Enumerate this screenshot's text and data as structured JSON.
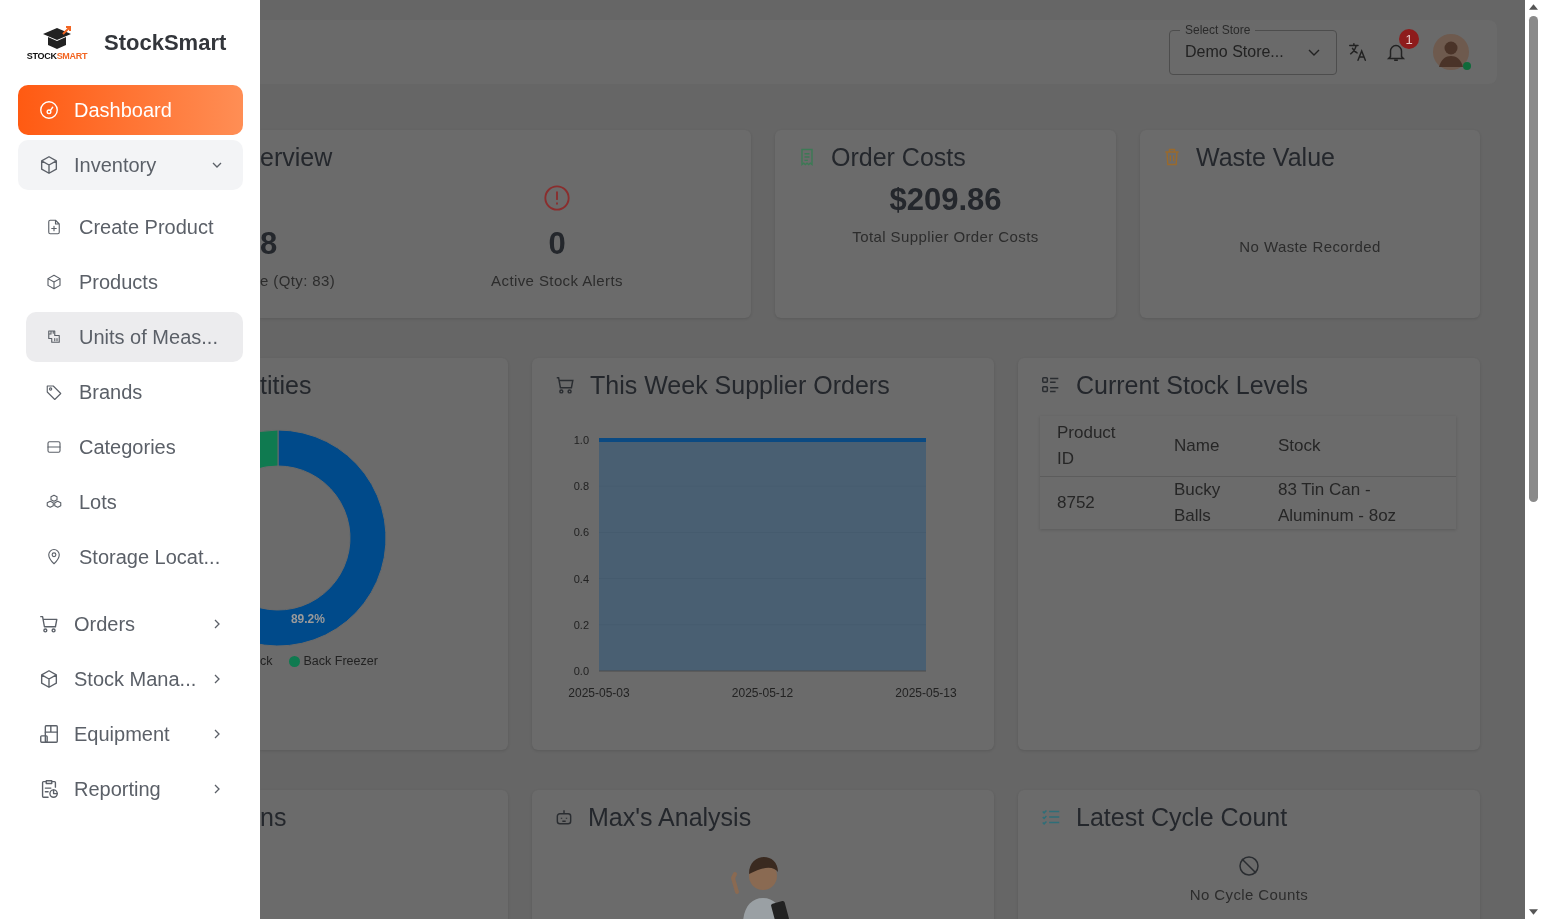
{
  "sidebar": {
    "logo_text_dark": "STOCK",
    "logo_text_accent": "SMART",
    "brand": "StockSmart",
    "items": [
      {
        "kind": "link",
        "label": "Dashboard",
        "selected": true
      },
      {
        "kind": "group",
        "label": "Inventory",
        "selected": false,
        "expanded": true,
        "children": [
          {
            "label": "Create Product",
            "highlighted": false
          },
          {
            "label": "Products",
            "highlighted": false
          },
          {
            "label": "Units of Meas...",
            "highlighted": true
          },
          {
            "label": "Brands",
            "highlighted": false
          },
          {
            "label": "Categories",
            "highlighted": false
          },
          {
            "label": "Lots",
            "highlighted": false
          },
          {
            "label": "Storage Locat...",
            "highlighted": false
          }
        ]
      },
      {
        "kind": "group",
        "label": "Orders",
        "selected": false,
        "expanded": false
      },
      {
        "kind": "group",
        "label": "Stock Mana...",
        "selected": false,
        "expanded": false
      },
      {
        "kind": "group",
        "label": "Equipment",
        "selected": false,
        "expanded": false
      },
      {
        "kind": "group",
        "label": "Reporting",
        "selected": false,
        "expanded": false
      }
    ]
  },
  "header": {
    "store_label": "Select Store",
    "store_value": "Demo Store...",
    "notification_count": "1",
    "user_online": true
  },
  "overview": {
    "title": "erview",
    "value": "8",
    "caption": "e (Qty: 83)",
    "alerts_value": "0",
    "alerts_caption": "Active Stock Alerts"
  },
  "order_costs": {
    "title": "Order Costs",
    "value": "$209.86",
    "caption": "Total Supplier Order Costs"
  },
  "waste_value": {
    "title": "Waste Value",
    "message": "No Waste Recorded"
  },
  "quantities": {
    "title": "tities",
    "chart_data": {
      "type": "donut",
      "categories": [
        "ck",
        "Back Freezer"
      ],
      "values": [
        89.2,
        10.8
      ],
      "colors": [
        "#004a8a",
        "#0f7a50"
      ],
      "value_labels": [
        "89.2%",
        null
      ]
    }
  },
  "supplier_orders": {
    "title": "This Week Supplier Orders",
    "chart_data": {
      "type": "area",
      "categories": [
        "2025-05-03",
        "2025-05-12",
        "2025-05-13"
      ],
      "series": [
        {
          "type": "area",
          "color": "#0b4a82",
          "values": [
            1,
            1,
            1
          ]
        }
      ],
      "ylim": [
        0,
        1
      ],
      "yticks": [
        {
          "value": 0,
          "label": "0.0"
        },
        {
          "value": 0.2,
          "label": "0.2"
        },
        {
          "value": 0.4,
          "label": "0.4"
        },
        {
          "value": 0.6,
          "label": "0.6"
        },
        {
          "value": 0.8,
          "label": "0.8"
        },
        {
          "value": 1,
          "label": "1.0"
        }
      ]
    }
  },
  "stock_levels": {
    "title": "Current Stock Levels",
    "columns": [
      "Product ID",
      "Name",
      "Stock"
    ],
    "rows": [
      [
        "8752",
        "Bucky Balls",
        "83 Tin Can - Aluminum - 8oz"
      ]
    ]
  },
  "row3": {
    "left_title": "ns",
    "analysis_title": "Max's Analysis",
    "cycle_title": "Latest Cycle Count",
    "cycle_message": "No Cycle Counts"
  }
}
